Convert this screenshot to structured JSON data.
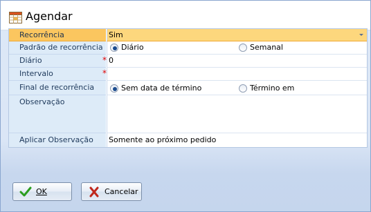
{
  "dialog": {
    "title": "Agendar",
    "icon": "calendar-icon"
  },
  "form": {
    "recorrencia": {
      "label": "Recorrência",
      "value": "Sim"
    },
    "padrao": {
      "label": "Padrão de recorrência",
      "options": [
        "Diário",
        "Semanal"
      ],
      "selected": "Diário"
    },
    "diario": {
      "label": "Diário",
      "value": "0",
      "required_mark": "*"
    },
    "intervalo": {
      "label": "Intervalo",
      "value": "",
      "required_mark": "*"
    },
    "final": {
      "label": "Final de recorrência",
      "options": [
        "Sem data de término",
        "Término em"
      ],
      "selected": "Sem data de término"
    },
    "observacao": {
      "label": "Observação",
      "value": ""
    },
    "aplicar": {
      "label": "Aplicar Observação",
      "value": "Somente ao próximo pedido"
    }
  },
  "buttons": {
    "ok": {
      "label": "OK",
      "icon": "check-icon"
    },
    "cancel": {
      "label": "Cancelar",
      "icon": "x-icon"
    }
  },
  "colors": {
    "selected_row": "#fdd77d",
    "label_bg": "#ddebf8",
    "required": "#e00000",
    "ok_icon": "#2a9d1e",
    "cancel_icon": "#c0281d"
  }
}
